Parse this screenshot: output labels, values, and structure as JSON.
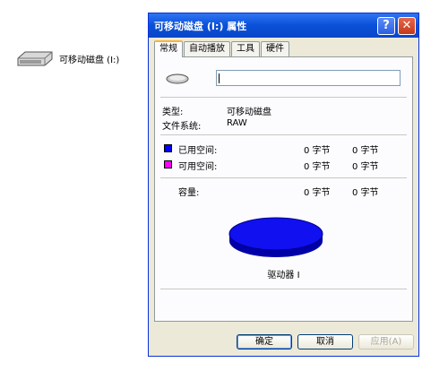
{
  "desktop": {
    "drive_label": "可移动磁盘 (I:)"
  },
  "window": {
    "title": "可移动磁盘 (I:) 属性",
    "help_label": "?",
    "close_label": "✕",
    "tabs": [
      {
        "label": "常规",
        "active": true
      },
      {
        "label": "自动播放",
        "active": false
      },
      {
        "label": "工具",
        "active": false
      },
      {
        "label": "硬件",
        "active": false
      }
    ]
  },
  "general": {
    "name_value": "",
    "type_label": "类型:",
    "type_value": "可移动磁盘",
    "fs_label": "文件系统:",
    "fs_value": "RAW",
    "used_label": "已用空间:",
    "used_bytes": "0 字节",
    "used_size": "0 字节",
    "free_label": "可用空间:",
    "free_bytes": "0 字节",
    "free_size": "0 字节",
    "cap_label": "容量:",
    "cap_bytes": "0 字节",
    "cap_size": "0 字节",
    "drive_caption": "驱动器 I"
  },
  "colors": {
    "used": "#0000ff",
    "free": "#ff00ff",
    "pie": "#1010f0"
  },
  "buttons": {
    "ok": "确定",
    "cancel": "取消",
    "apply": "应用(A)"
  }
}
